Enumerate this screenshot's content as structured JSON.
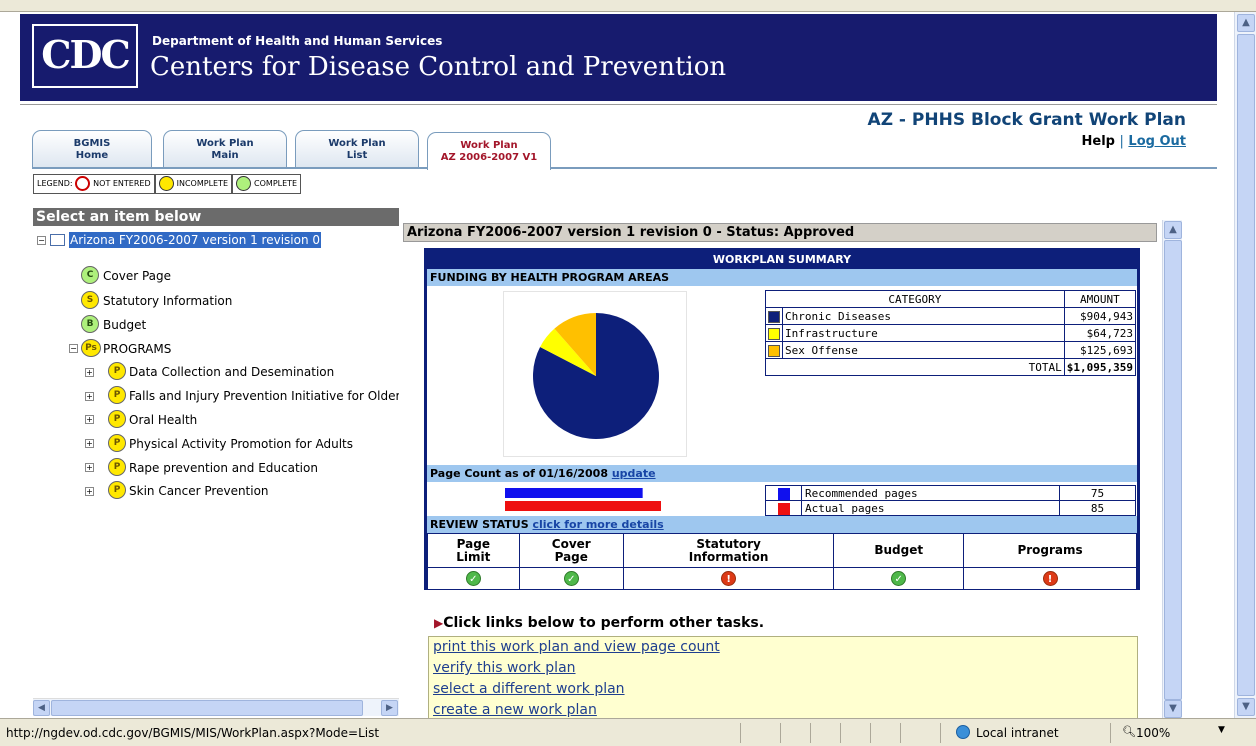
{
  "header": {
    "logo": "CDC",
    "department": "Department of Health and Human Services",
    "agency": "Centers for Disease Control and Prevention"
  },
  "page_title": "AZ - PHHS Block Grant Work Plan",
  "links": {
    "help": "Help",
    "separator": "|",
    "logout": "Log Out"
  },
  "tabs": [
    {
      "line1": "BGMIS",
      "line2": "Home"
    },
    {
      "line1": "Work Plan",
      "line2": "Main"
    },
    {
      "line1": "Work Plan",
      "line2": "List"
    },
    {
      "line1": "Work Plan",
      "line2": "AZ 2006-2007 V1"
    }
  ],
  "legend": {
    "label": "LEGEND:",
    "not_entered": "NOT ENTERED",
    "incomplete": "INCOMPLETE",
    "complete": "COMPLETE"
  },
  "left_panel": {
    "header": "Select an item below",
    "root": "Arizona FY2006-2007 version 1 revision 0",
    "items": [
      {
        "badge": "C",
        "label": "Cover Page"
      },
      {
        "badge": "S",
        "label": "Statutory Information"
      },
      {
        "badge": "B",
        "label": "Budget"
      },
      {
        "badge": "Ps",
        "label": "PROGRAMS"
      }
    ],
    "programs": [
      "Data Collection and Desemination",
      "Falls and Injury Prevention Initiative for Older",
      "Oral Health",
      "Physical Activity Promotion for Adults",
      "Rape prevention and Education",
      "Skin Cancer Prevention"
    ],
    "program_badge": "P"
  },
  "right_panel": {
    "header": "Arizona FY2006-2007 version 1 revision 0 - Status: Approved",
    "summary_title": "WORKPLAN SUMMARY",
    "funding_title": "FUNDING BY HEALTH PROGRAM AREAS",
    "category_header": "CATEGORY",
    "amount_header": "AMOUNT",
    "categories": [
      {
        "name": "Chronic Diseases",
        "amount": "$904,943",
        "color": "#0d1f7a"
      },
      {
        "name": "Infrastructure",
        "amount": "$64,723",
        "color": "#ffff00"
      },
      {
        "name": "Sex Offense",
        "amount": "$125,693",
        "color": "#ffc000"
      }
    ],
    "total_label": "TOTAL",
    "total_amount": "$1,095,359",
    "page_count_label": "Page Count as of 01/16/2008",
    "update_link": "update",
    "pages": [
      {
        "name": "Recommended pages",
        "value": "75",
        "color": "#1010ee"
      },
      {
        "name": "Actual pages",
        "value": "85",
        "color": "#ee1010"
      }
    ],
    "review_label": "REVIEW STATUS",
    "review_link": "click for more details",
    "review_columns": [
      {
        "line1": "Page",
        "line2": "Limit",
        "status": "complete"
      },
      {
        "line1": "Cover",
        "line2": "Page",
        "status": "complete"
      },
      {
        "line1": "Statutory",
        "line2": "Information",
        "status": "alert"
      },
      {
        "line1": "Budget",
        "line2": "",
        "status": "complete"
      },
      {
        "line1": "Programs",
        "line2": "",
        "status": "alert"
      }
    ],
    "tasks_header": "Click links below to perform other tasks.",
    "tasks": [
      "print this work plan and view page count",
      "verify this work plan",
      "select a different work plan",
      "create a new work plan"
    ]
  },
  "status_bar": {
    "url": "http://ngdev.od.cdc.gov/BGMIS/MIS/WorkPlan.aspx?Mode=List",
    "zone": "Local intranet",
    "zoom": "100%"
  },
  "chart_data": [
    {
      "type": "pie",
      "categories": [
        "Chronic Diseases",
        "Infrastructure",
        "Sex Offense"
      ],
      "values": [
        904943,
        64723,
        125693
      ],
      "colors": [
        "#0d1f7a",
        "#ffff00",
        "#ffc000"
      ]
    },
    {
      "type": "bar",
      "categories": [
        "Recommended pages",
        "Actual pages"
      ],
      "values": [
        75,
        85
      ],
      "colors": [
        "#1010ee",
        "#ee1010"
      ]
    }
  ]
}
